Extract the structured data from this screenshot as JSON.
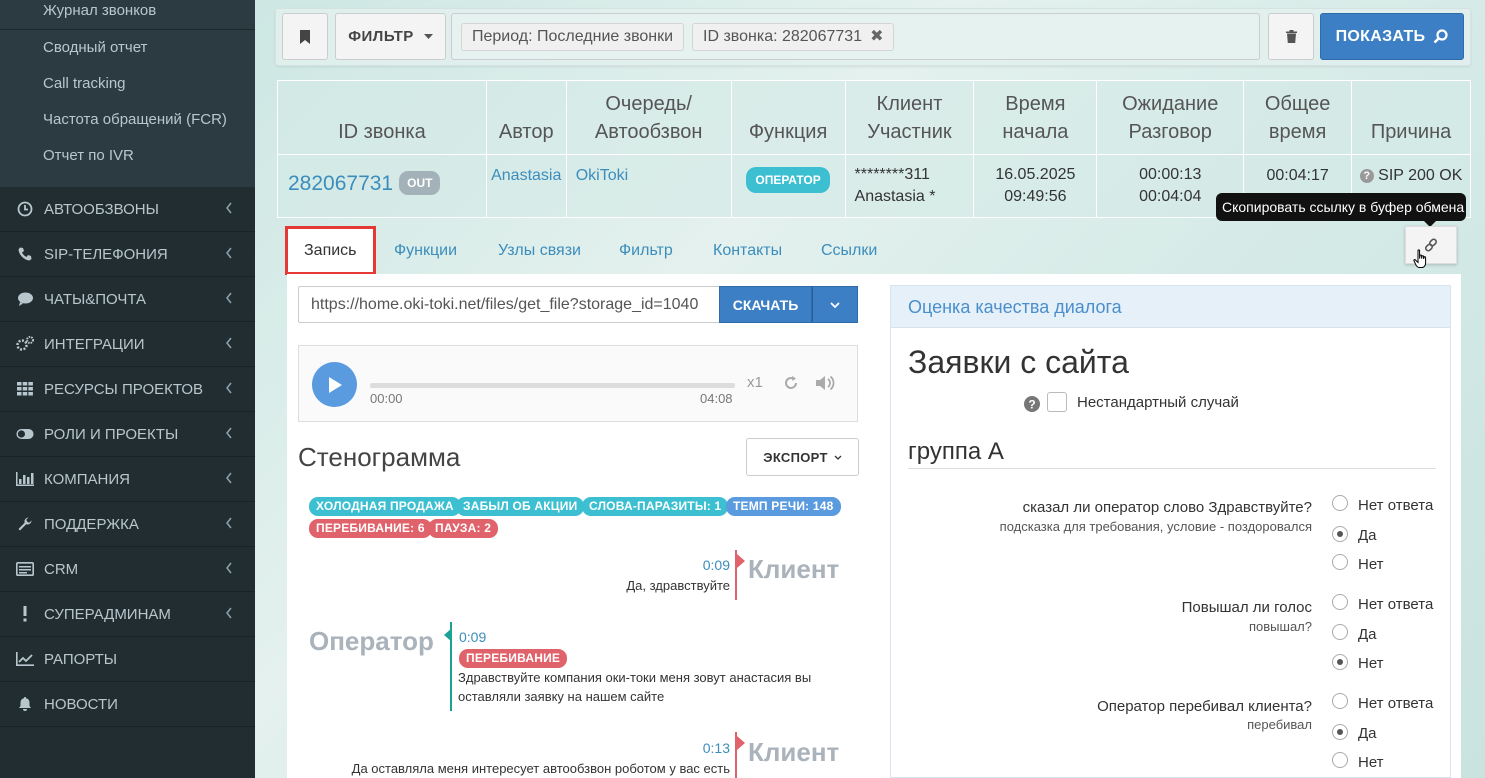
{
  "sidebar": {
    "sub_items": [
      {
        "label": "Журнал звонков"
      },
      {
        "label": "Сводный отчет"
      },
      {
        "label": "Call tracking"
      },
      {
        "label": "Частота обращений (FCR)"
      },
      {
        "label": "Отчет по IVR"
      }
    ],
    "nav_items": [
      {
        "label": "АВТООБЗВОНЫ",
        "icon": "clock-icon"
      },
      {
        "label": "SIP-ТЕЛЕФОНИЯ",
        "icon": "phone-icon"
      },
      {
        "label": "ЧАТЫ&ПОЧТА",
        "icon": "chat-icon"
      },
      {
        "label": "ИНТЕГРАЦИИ",
        "icon": "gears-icon"
      },
      {
        "label": "РЕСУРСЫ ПРОЕКТОВ",
        "icon": "grid-icon"
      },
      {
        "label": "РОЛИ И ПРОЕКТЫ",
        "icon": "toggle-icon"
      },
      {
        "label": "КОМПАНИЯ",
        "icon": "bar-chart-icon"
      },
      {
        "label": "ПОДДЕРЖКА",
        "icon": "wrench-icon"
      },
      {
        "label": "CRM",
        "icon": "card-icon"
      },
      {
        "label": "СУПЕРАДМИНАМ",
        "icon": "exclamation-icon"
      },
      {
        "label": "РАПОРТЫ",
        "icon": "line-chart-icon"
      },
      {
        "label": "НОВОСТИ",
        "icon": "bell-icon"
      }
    ]
  },
  "filterbar": {
    "filter_label": "ФИЛЬТР",
    "tag_period": "Период: Последние звонки",
    "tag_id": "ID звонка: 282067731",
    "tag_remove": "✖",
    "show_label": "ПОКАЗАТЬ"
  },
  "call_table": {
    "headers": {
      "id": "ID звонка",
      "author": "Автор",
      "queue_1": "Очередь/",
      "queue_2": "Автообзвон",
      "function": "Функция",
      "client_1": "Клиент",
      "client_2": "Участник",
      "start_1": "Время",
      "start_2": "начала",
      "wait_1": "Ожидание",
      "wait_2": "Разговор",
      "total_1": "Общее",
      "total_2": "время",
      "reason": "Причина"
    },
    "row": {
      "id": "282067731",
      "direction": "OUT",
      "author": "Anastasia",
      "queue": "OkiToki",
      "function": "ОПЕРАТОР",
      "client": "********311",
      "participant": "Anastasia *",
      "date": "16.05.2025",
      "time": "09:49:56",
      "wait": "00:00:13",
      "talk": "00:04:04",
      "total": "00:04:17",
      "reason": "SIP 200 OK"
    }
  },
  "tooltip": "Скопировать ссылку в буфер обмена",
  "tabs": [
    {
      "label": "Запись"
    },
    {
      "label": "Функции"
    },
    {
      "label": "Узлы связи"
    },
    {
      "label": "Фильтр"
    },
    {
      "label": "Контакты"
    },
    {
      "label": "Ссылки"
    }
  ],
  "record": {
    "url": "https://home.oki-toki.net/files/get_file?storage_id=1040",
    "download_label": "СКАЧАТЬ",
    "player": {
      "current": "00:00",
      "duration": "04:08",
      "speed": "x1",
      "progress": 0
    }
  },
  "transcript": {
    "title": "Стенограмма",
    "export_label": "ЭКСПОРТ",
    "chips": [
      {
        "label": "ХОЛОДНАЯ ПРОДАЖА",
        "color": "#3cbfd0"
      },
      {
        "label": "ЗАБЫЛ ОБ АКЦИИ",
        "color": "#3cbfd0"
      },
      {
        "label": "СЛОВА-ПАРАЗИТЫ: 1",
        "color": "#3cbfd0"
      },
      {
        "label": "ТЕМП РЕЧИ: 148",
        "color": "#5a9be0"
      },
      {
        "label": "ПЕРЕБИВАНИЕ: 6",
        "color": "#e0636b"
      },
      {
        "label": "ПАУЗА: 2",
        "color": "#e0636b"
      }
    ],
    "messages": [
      {
        "speaker": "Клиент",
        "time": "0:09",
        "text": "Да, здравствуйте"
      },
      {
        "speaker": "Оператор",
        "time": "0:09",
        "tag": "ПЕРЕБИВАНИЕ",
        "text_1": "Здравствуйте компания оки-токи меня зовут анастасия вы",
        "text_2": "оставляли заявку на нашем сайте"
      },
      {
        "speaker": "Клиент",
        "time": "0:13",
        "text": "Да оставляла меня интересует автообзвон роботом у вас есть"
      }
    ]
  },
  "qa": {
    "header": "Оценка качества диалога",
    "title": "Заявки с сайта",
    "nonstandard_label": "Нестандартный случай",
    "group": "группа А",
    "questions": [
      {
        "text": "сказал ли оператор слово Здравствуйте?",
        "hint": "подсказка для требования, условие - поздоровался",
        "options": [
          "Нет ответа",
          "Да",
          "Нет"
        ],
        "selected": "Да"
      },
      {
        "text": "Повышал ли голос",
        "hint": "повышал?",
        "options": [
          "Нет ответа",
          "Да",
          "Нет"
        ],
        "selected": "Нет"
      },
      {
        "text": "Оператор перебивал клиента?",
        "hint": "перебивал",
        "options": [
          "Нет ответа",
          "Да",
          "Нет"
        ],
        "selected": "Да"
      }
    ]
  }
}
